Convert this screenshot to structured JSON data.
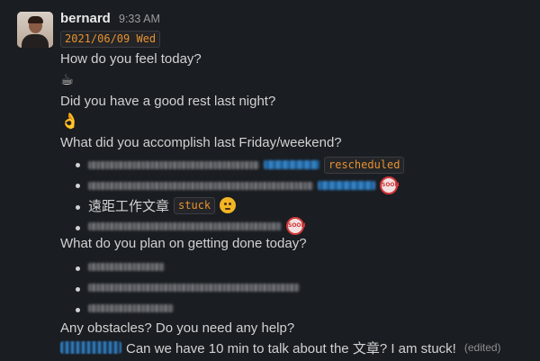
{
  "message": {
    "author": "bernard",
    "time": "9:33 AM",
    "date_code": "2021/06/09 Wed",
    "q1": "How do you feel today?",
    "q1_emoji": "☕",
    "q2": "Did you have a good rest last night?",
    "q2_emoji": "👌",
    "q3": "What did you accomplish last Friday/weekend?",
    "accomplished": [
      {
        "tag": "rescheduled"
      },
      {
        "icon": "soon-icon"
      },
      {
        "text": "遠距工作文章",
        "tag": "stuck",
        "icon": "angry-face-icon"
      },
      {
        "icon": "soon-icon"
      }
    ],
    "q4": "What do you plan on getting done today?",
    "q5": "Any obstacles? Do you need any help?",
    "final_text": "Can we have 10 min to talk about the 文章? I am stuck!",
    "edited_label": "(edited)",
    "soon_label": "SOON"
  },
  "colors": {
    "background": "#1a1d21",
    "text": "#d1d2d3",
    "code_text": "#e8912d",
    "mention_blue": "#2f79b8"
  }
}
